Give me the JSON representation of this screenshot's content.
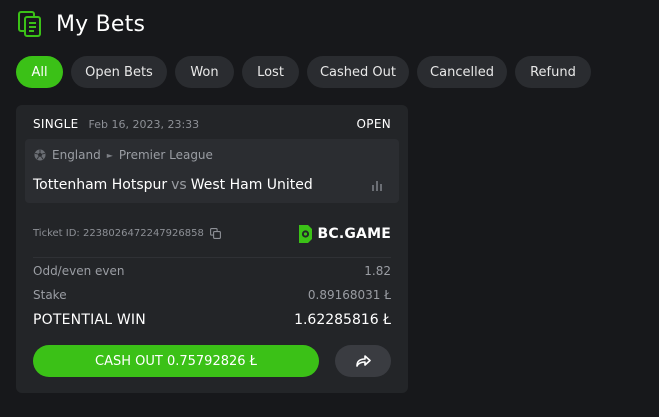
{
  "header": {
    "title": "My Bets",
    "icon": "bets-icon",
    "accent": "#3bc117"
  },
  "filters": [
    {
      "label": "All",
      "active": true
    },
    {
      "label": "Open Bets",
      "active": false
    },
    {
      "label": "Won",
      "active": false
    },
    {
      "label": "Lost",
      "active": false
    },
    {
      "label": "Cashed Out",
      "active": false
    },
    {
      "label": "Cancelled",
      "active": false
    },
    {
      "label": "Refund",
      "active": false
    }
  ],
  "bet": {
    "type": "SINGLE",
    "date": "Feb 16, 2023, 23:33",
    "status": "OPEN",
    "country": "England",
    "league": "Premier League",
    "home_team": "Tottenham Hotspur",
    "vs": "vs",
    "away_team": "West Ham United",
    "ticket_id": "Ticket ID: 2238026472247926858",
    "brand": "BC.GAME",
    "market": "Odd/even even",
    "odds": "1.82",
    "stake_label": "Stake",
    "stake": "0.89168031 Ł",
    "potential_win_label": "POTENTIAL WIN",
    "potential_win": "1.62285816 Ł",
    "cashout_label": "CASH OUT 0.75792826 Ł"
  }
}
